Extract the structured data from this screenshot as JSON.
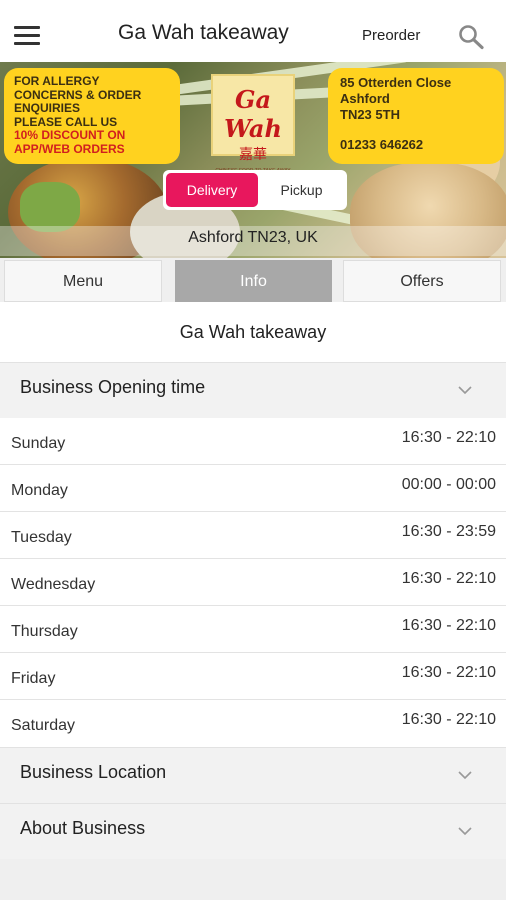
{
  "header": {
    "title": "Ga Wah takeaway",
    "preorder_label": "Preorder",
    "menu_icon": "hamburger-menu-icon",
    "search_icon": "search-icon"
  },
  "banner": {
    "allergy_lines": [
      "FOR ALLERGY",
      "CONCERNS & ORDER",
      "ENQUIRIES",
      "PLEASE CALL US"
    ],
    "discount_lines": [
      "10% DISCOUNT ON",
      "APP/WEB ORDERS"
    ],
    "logo_text": "Ga Wah",
    "logo_chinese": "嘉華",
    "logo_small": "CHINESE FOOD TO TAKE AWAY",
    "address_lines": [
      "85 Otterden Close",
      "Ashford",
      "TN23 5TH"
    ],
    "phone": "01233 646262",
    "delivery_label": "Delivery",
    "pickup_label": "Pickup",
    "location": "Ashford TN23, UK",
    "accent_color": "#e8175d",
    "box_color": "#ffd21f"
  },
  "tabs": [
    {
      "label": "Menu"
    },
    {
      "label": "Info"
    },
    {
      "label": "Offers"
    }
  ],
  "info": {
    "business_name": "Ga Wah takeaway",
    "opening_time_label": "Business Opening time",
    "hours": [
      {
        "day": "Sunday",
        "time": "16:30 - 22:10"
      },
      {
        "day": "Monday",
        "time": "00:00 - 00:00"
      },
      {
        "day": "Tuesday",
        "time": "16:30 - 23:59"
      },
      {
        "day": "Wednesday",
        "time": "16:30 - 22:10"
      },
      {
        "day": "Thursday",
        "time": "16:30 - 22:10"
      },
      {
        "day": "Friday",
        "time": "16:30 - 22:10"
      },
      {
        "day": "Saturday",
        "time": "16:30 - 22:10"
      }
    ],
    "location_label": "Business Location",
    "about_label": "About Business"
  }
}
